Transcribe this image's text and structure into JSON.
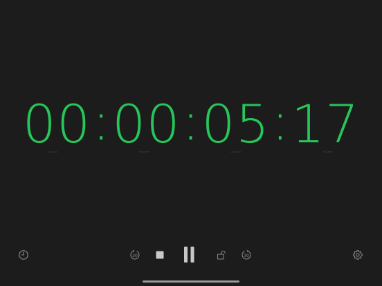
{
  "timer": {
    "hours": "00",
    "minutes": "00",
    "seconds": "05",
    "frames": "17",
    "separator": ":"
  },
  "labels": {
    "hours": "HOURS",
    "minutes": "MINUTES",
    "seconds": "SECONDS",
    "frames": "FRAMES"
  },
  "toolbar": {
    "history": "clock-history-icon",
    "rewind": "rewind-30-icon",
    "rewind_value": "30",
    "stop": "stop-icon",
    "pause": "pause-icon",
    "lock": "unlock-icon",
    "forward": "forward-30-icon",
    "forward_value": "30",
    "settings": "gear-icon"
  },
  "colors": {
    "background": "#1c1c1c",
    "digits": "#27c65a",
    "icons": "#8e8e8e",
    "controls": "#c8c8c8"
  }
}
